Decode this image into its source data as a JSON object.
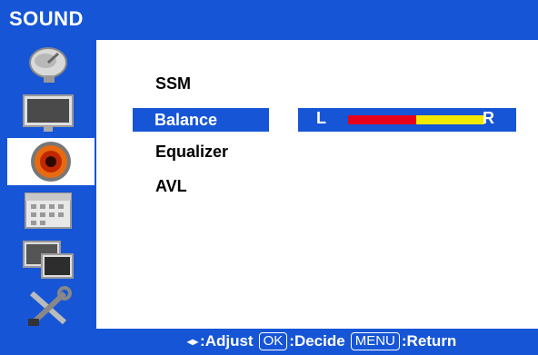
{
  "header": {
    "title": "SOUND"
  },
  "sidebar": {
    "items": [
      {
        "name": "satellite-dish-icon"
      },
      {
        "name": "tv-screen-icon"
      },
      {
        "name": "speaker-icon",
        "active": true
      },
      {
        "name": "calendar-icon"
      },
      {
        "name": "multi-screen-icon"
      },
      {
        "name": "tools-icon"
      }
    ]
  },
  "menu": {
    "items": [
      {
        "label": "SSM"
      },
      {
        "label": "Balance",
        "selected": true
      },
      {
        "label": "Equalizer"
      },
      {
        "label": "AVL"
      }
    ]
  },
  "balance": {
    "left_label": "L",
    "right_label": "R",
    "level_fraction": 0.5
  },
  "footer": {
    "adjust_arrows": "◂▸",
    "adjust_label": ":Adjust",
    "ok_key": "OK",
    "decide_label": ":Decide",
    "menu_key": "MENU",
    "return_label": ":Return"
  },
  "colors": {
    "background_blue": "#1655d6",
    "balance_left": "#e8001b",
    "balance_right": "#f2e900"
  }
}
